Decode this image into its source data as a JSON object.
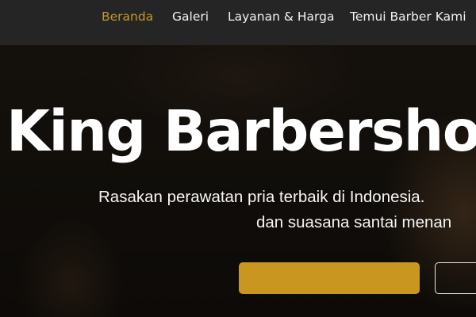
{
  "nav": {
    "items": [
      {
        "label": "Beranda",
        "active": true
      },
      {
        "label": "Galeri",
        "active": false
      },
      {
        "label": "Layanan & Harga",
        "active": false
      },
      {
        "label": "Temui Barber Kami",
        "active": false
      }
    ],
    "accent_color": "#c9971f",
    "background_color": "#252525"
  },
  "hero": {
    "title": "King Barbershop",
    "subtitle_line_1": "Rasakan perawatan pria terbaik di Indonesia.",
    "subtitle_line_2": "dan suasana santai menan",
    "primary_button_color": "#c9971f"
  }
}
